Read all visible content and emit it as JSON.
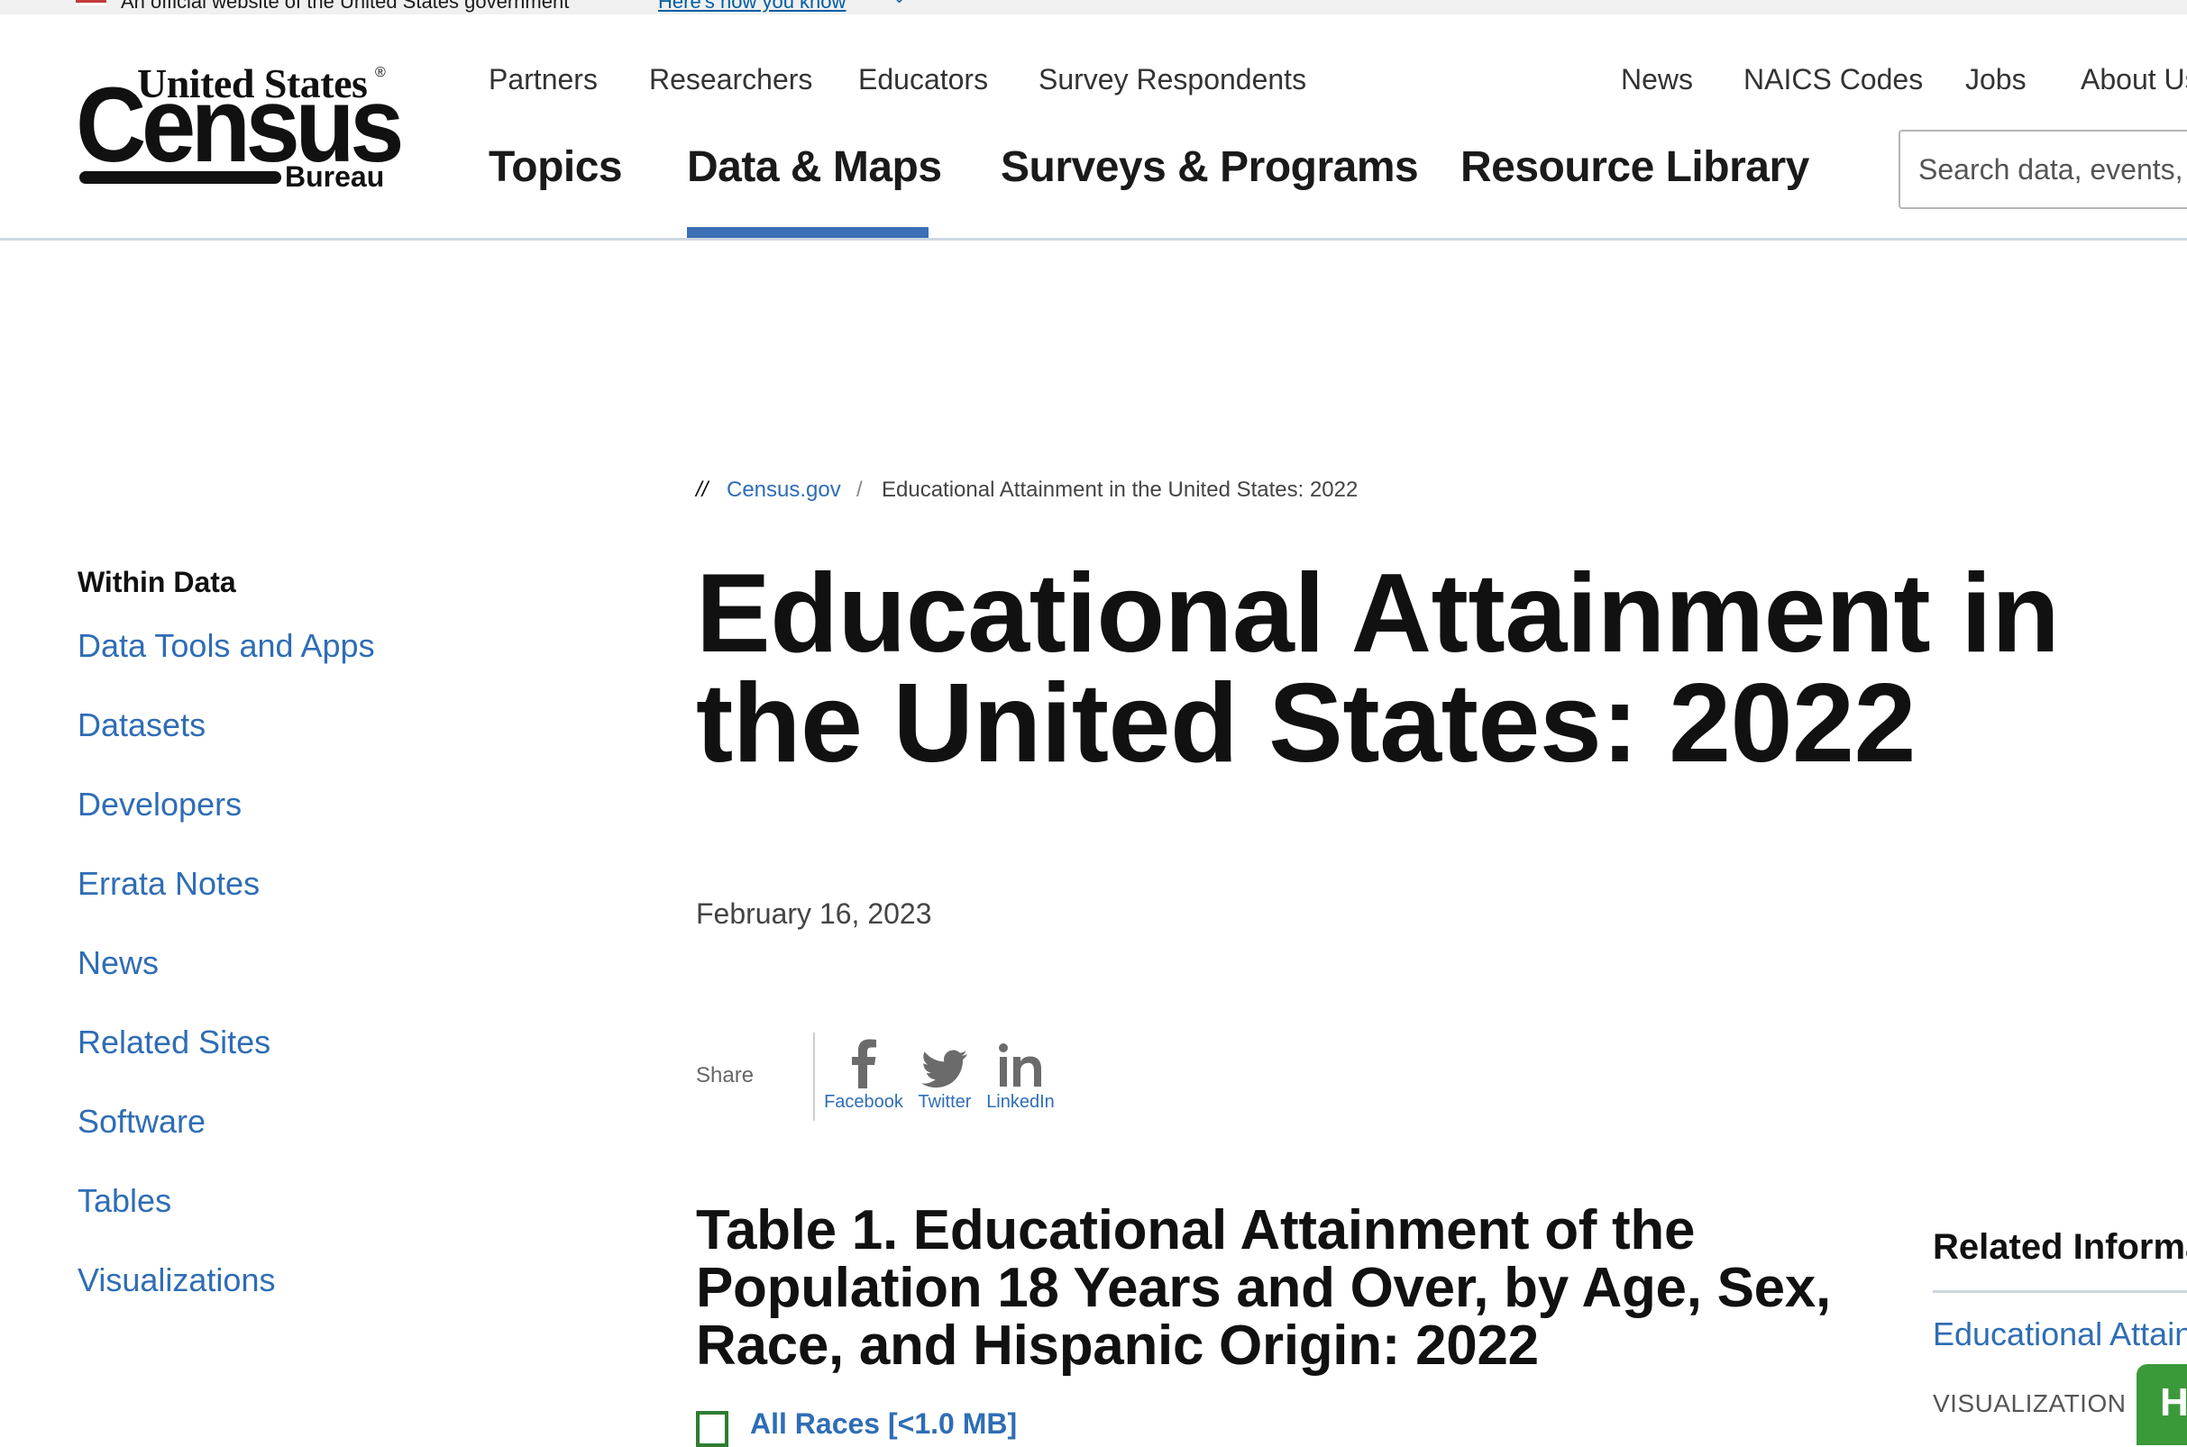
{
  "gov_banner": {
    "text": "An official website of the United States government",
    "link": "Here's how you know",
    "chevron": "⌄"
  },
  "logo": {
    "top": "United States",
    "registered": "®",
    "main": "Census",
    "bottom": "Bureau"
  },
  "utility_nav": [
    "Partners",
    "Researchers",
    "Educators",
    "Survey Respondents",
    "News",
    "NAICS Codes",
    "Jobs",
    "About Us"
  ],
  "main_nav": [
    "Topics",
    "Data & Maps",
    "Surveys & Programs",
    "Resource Library"
  ],
  "active_main_nav": "Data & Maps",
  "accent_color": "#3b6fb6",
  "link_color": "#2f6db5",
  "search": {
    "placeholder": "Search data, events, resources, and more"
  },
  "sidebar": {
    "title": "Within Data",
    "items": [
      "Data Tools and Apps",
      "Datasets",
      "Developers",
      "Errata Notes",
      "News",
      "Related Sites",
      "Software",
      "Tables",
      "Visualizations"
    ]
  },
  "breadcrumb": {
    "mark": "//",
    "home": "Census.gov",
    "separator": "/",
    "current": "Educational Attainment in the United States: 2022"
  },
  "page": {
    "title": "Educational Attainment in the United States: 2022",
    "date": "February 16, 2023"
  },
  "share": {
    "label": "Share",
    "items": [
      {
        "icon": "facebook-icon",
        "glyph": "f",
        "label": "Facebook"
      },
      {
        "icon": "twitter-icon",
        "glyph": "",
        "label": "Twitter"
      },
      {
        "icon": "linkedin-icon",
        "glyph": "in",
        "label": "LinkedIn"
      }
    ]
  },
  "table_heading": "Table 1. Educational Attainment of the Population 18 Years and Over, by Age, Sex, Race, and Hispanic Origin: 2022",
  "download": {
    "icon": "excel-file-icon",
    "label": "All Races [<1.0 MB]"
  },
  "related": {
    "title": "Related Information",
    "link": "Educational Attainment",
    "tag": "VISUALIZATION",
    "help_button": "H"
  }
}
